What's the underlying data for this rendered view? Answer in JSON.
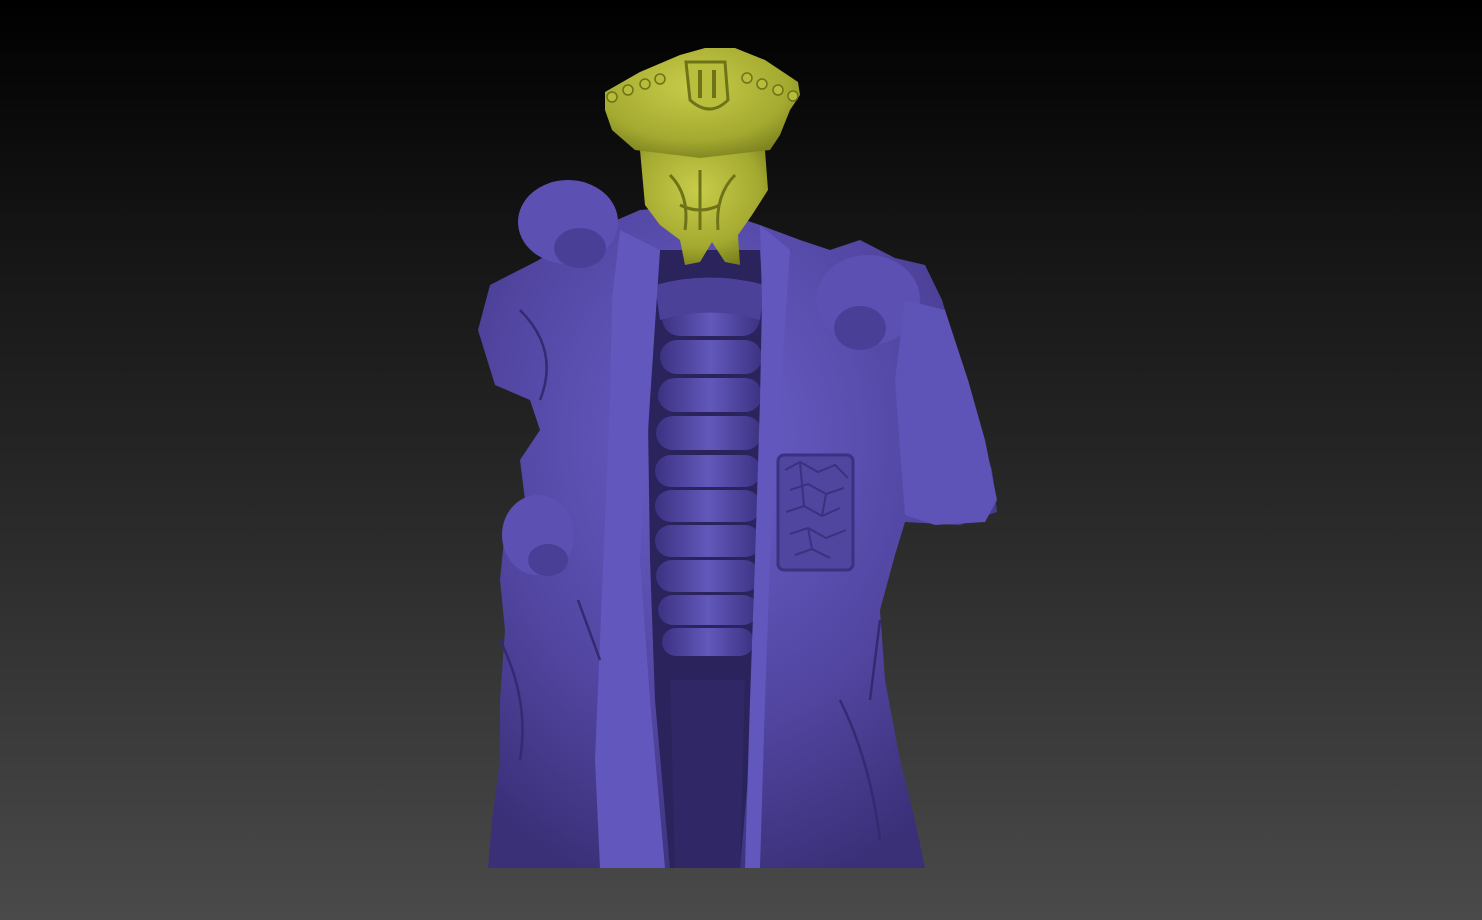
{
  "viewport": {
    "background_top": "#000000",
    "background_bottom": "#4a4a4a"
  },
  "model": {
    "subtools": [
      {
        "name": "hat-and-head",
        "color": "#aab035"
      },
      {
        "name": "coat-and-body",
        "color": "#5549a6"
      }
    ]
  }
}
